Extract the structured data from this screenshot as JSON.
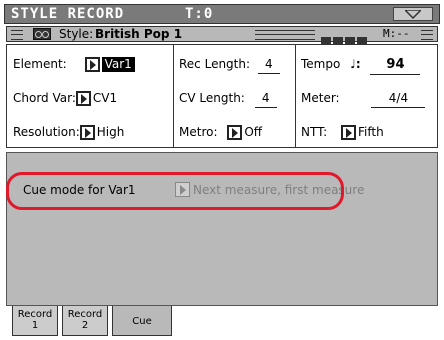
{
  "title_bar": {
    "app_title": "STYLE RECORD",
    "track_indicator": "T:0"
  },
  "style_bar": {
    "style_label": "Style:",
    "style_name": "British Pop 1",
    "measure": "M:--"
  },
  "params": {
    "element": {
      "label": "Element:",
      "value": "Var1"
    },
    "chord_var": {
      "label": "Chord Var:",
      "value": "CV1"
    },
    "resolution": {
      "label": "Resolution:",
      "value": "High"
    },
    "rec_length": {
      "label": "Rec Length:",
      "value": "4"
    },
    "cv_length": {
      "label": "CV Length:",
      "value": "4"
    },
    "metro": {
      "label": "Metro:",
      "value": "Off"
    },
    "tempo": {
      "label": "Tempo",
      "note": "♩:",
      "value": "94"
    },
    "meter": {
      "label": "Meter:",
      "value": "4/4"
    },
    "ntt": {
      "label": "NTT:",
      "value": "Fifth"
    }
  },
  "panel": {
    "cue_label": "Cue mode for Var1",
    "cue_value": "Next measure, first measure"
  },
  "tabs": [
    {
      "line1": "Record",
      "line2": "1"
    },
    {
      "line1": "Record",
      "line2": "2"
    },
    {
      "line1": "Cue",
      "line2": ""
    }
  ],
  "highlight_color": "#e0192b"
}
